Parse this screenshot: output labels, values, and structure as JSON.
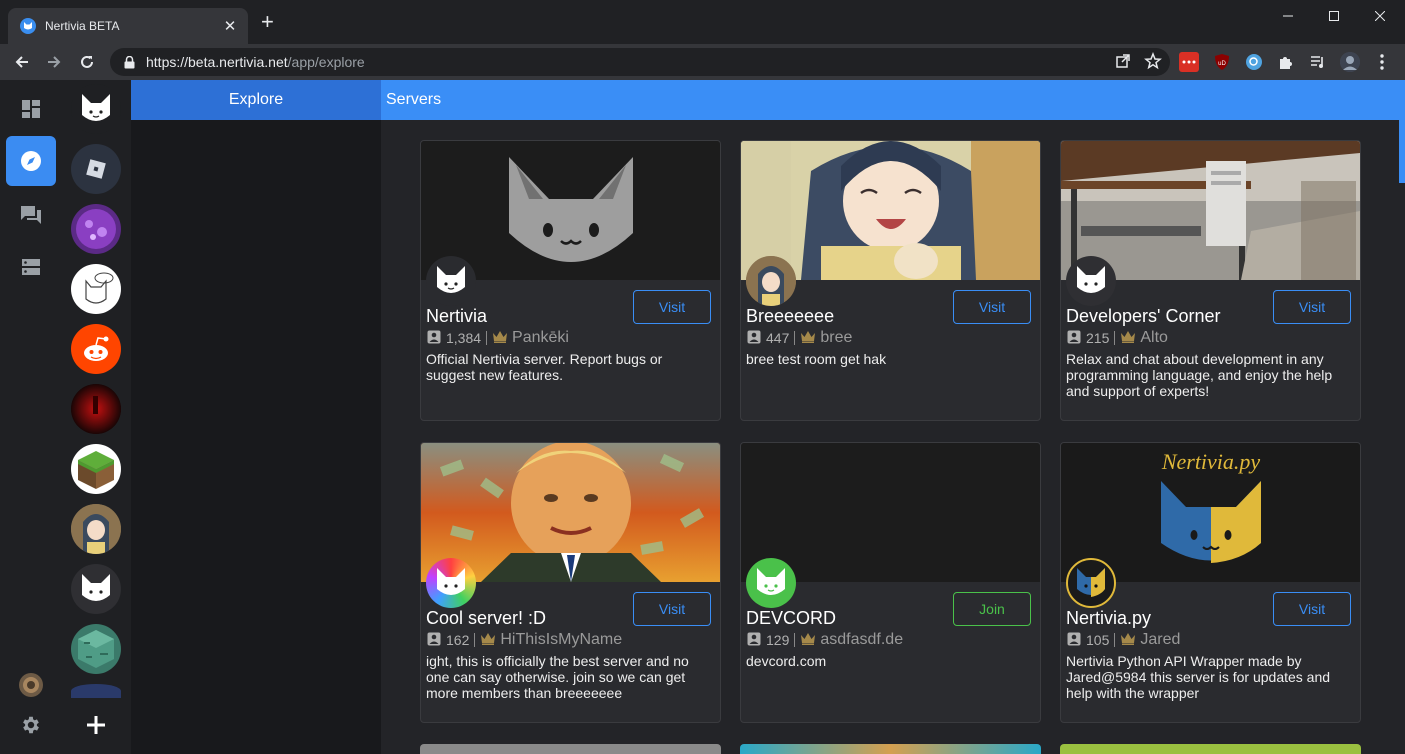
{
  "browser": {
    "tab_title": "Nertivia BETA",
    "url_host": "https://beta.nertivia.net",
    "url_path": "/app/explore"
  },
  "icons": {
    "navrail": [
      "dashboard-icon",
      "explore-compass-icon",
      "messages-icon",
      "servers-icon",
      "settings-gear-icon"
    ],
    "server_list_add": "plus-icon"
  },
  "sidebar": {
    "title": "Explore"
  },
  "main": {
    "title": "Servers"
  },
  "colors": {
    "accent": "#3a8ef6",
    "join": "#4ac14a",
    "card_bg": "#2a2b2f",
    "owner_crown": "#a5894a"
  },
  "servers": [
    {
      "name": "Nertivia",
      "members": "1,384",
      "owner": "Pankēki",
      "description": "Official Nertivia server. Report bugs or suggest new features.",
      "action": "Visit"
    },
    {
      "name": "Breeeeeee",
      "members": "447",
      "owner": "bree",
      "description": "bree test room get hak",
      "action": "Visit"
    },
    {
      "name": "Developers' Corner",
      "members": "215",
      "owner": "Alto",
      "description": "Relax and chat about development in any programming language, and enjoy the help and support of experts!",
      "action": "Visit"
    },
    {
      "name": "Cool server! :D",
      "members": "162",
      "owner": "HiThisIsMyName",
      "description": "ight, this is officially the best server and no one can say otherwise. join so we can get more members than breeeeeee",
      "action": "Visit"
    },
    {
      "name": "DEVCORD",
      "members": "129",
      "owner": "asdfasdf.de",
      "description": "devcord.com",
      "action": "Join"
    },
    {
      "name": "Nertivia.py",
      "members": "105",
      "owner": "Jared",
      "description": "Nertivia Python API Wrapper made by Jared@5984 this server is for updates and help with the wrapper",
      "action": "Visit"
    }
  ],
  "banner_text": {
    "nertivia_py": "Nertivia.py"
  }
}
